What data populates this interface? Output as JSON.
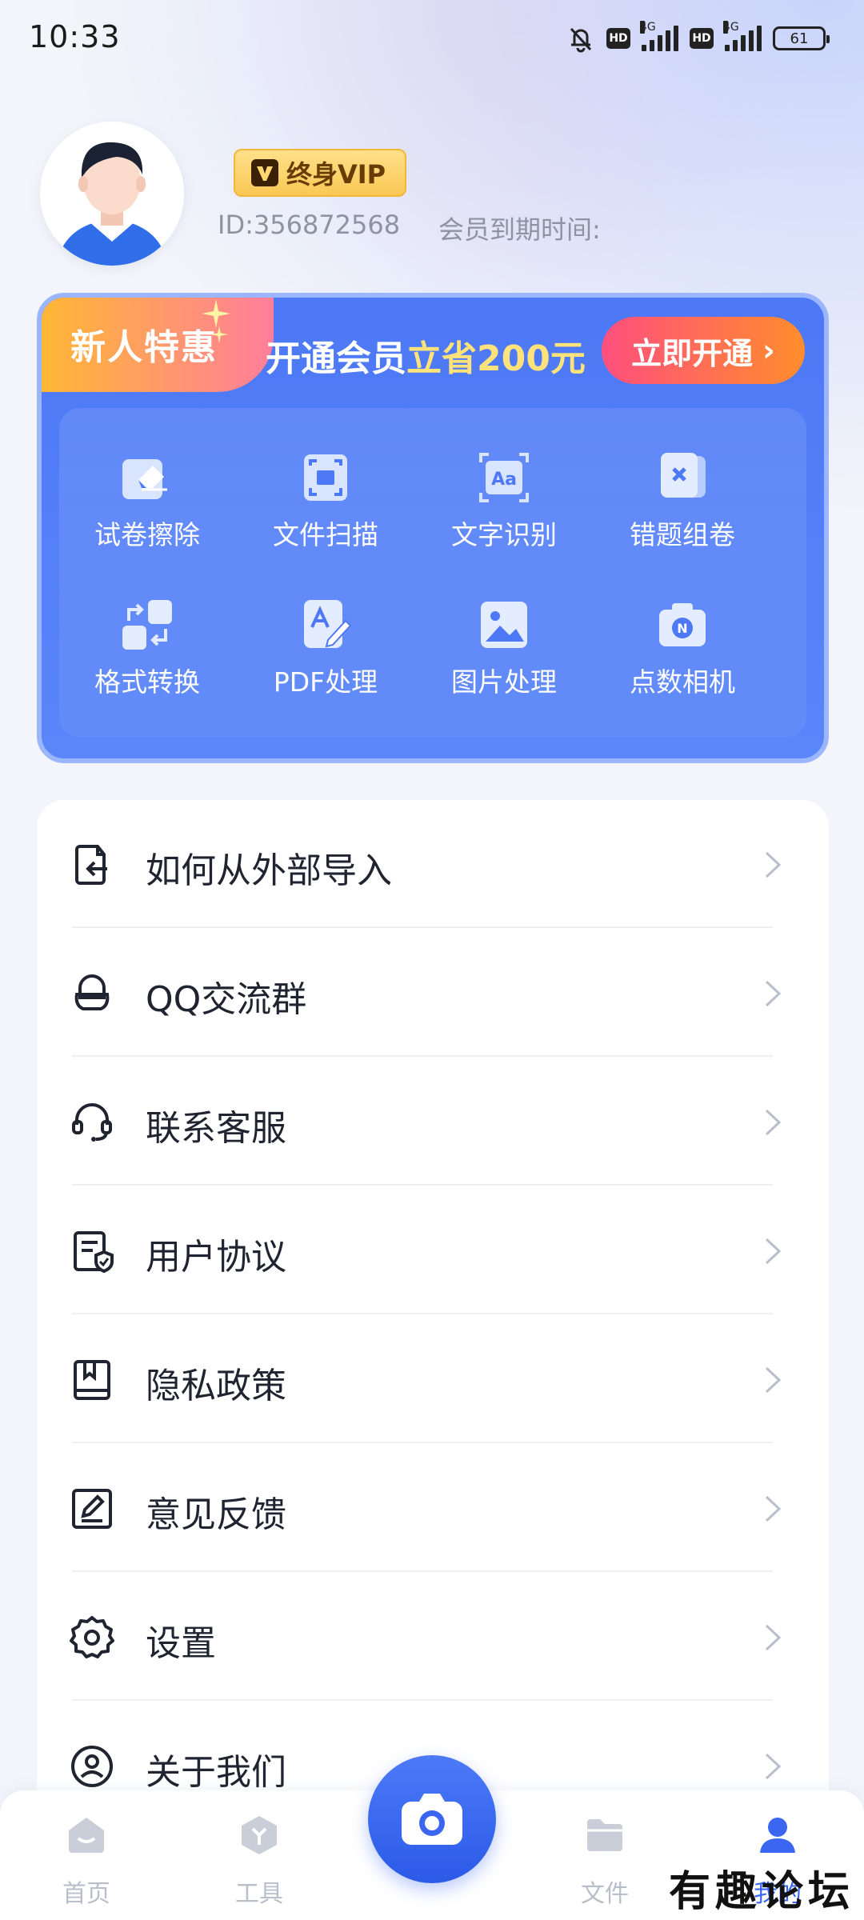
{
  "status_bar": {
    "time": "10:33",
    "network_1": "4G",
    "network_2": "4G",
    "hd": "HD",
    "battery": "61"
  },
  "profile": {
    "vip_label": "终身VIP",
    "user_id": "ID:356872568",
    "expire_label": "会员到期时间:"
  },
  "promo": {
    "tag": "新人特惠",
    "text_prefix": "开通会员",
    "text_highlight": "立省200元",
    "button_label": "立即开通",
    "button_arrow": "›",
    "features": [
      {
        "label": "试卷擦除",
        "icon": "eraser-icon"
      },
      {
        "label": "文件扫描",
        "icon": "scan-icon"
      },
      {
        "label": "文字识别",
        "icon": "text-recognition-icon"
      },
      {
        "label": "错题组卷",
        "icon": "wrong-question-icon"
      },
      {
        "label": "格式转换",
        "icon": "convert-icon"
      },
      {
        "label": "PDF处理",
        "icon": "pdf-edit-icon"
      },
      {
        "label": "图片处理",
        "icon": "image-icon"
      },
      {
        "label": "点数相机",
        "icon": "count-camera-icon"
      }
    ]
  },
  "menu": {
    "items": [
      {
        "label": "如何从外部导入",
        "icon": "import-icon"
      },
      {
        "label": "QQ交流群",
        "icon": "qq-icon"
      },
      {
        "label": "联系客服",
        "icon": "headset-icon"
      },
      {
        "label": "用户协议",
        "icon": "agreement-icon"
      },
      {
        "label": "隐私政策",
        "icon": "book-icon"
      },
      {
        "label": "意见反馈",
        "icon": "feedback-icon"
      },
      {
        "label": "设置",
        "icon": "gear-icon"
      },
      {
        "label": "关于我们",
        "icon": "about-icon"
      }
    ]
  },
  "nav": {
    "home": "首页",
    "tools": "工具",
    "files": "文件",
    "mine": "我的"
  },
  "colors": {
    "accent": "#3a66f2",
    "promo_bg": "#4d78f6",
    "vip_gold": "#f9c855"
  },
  "watermark": "有趣论坛"
}
